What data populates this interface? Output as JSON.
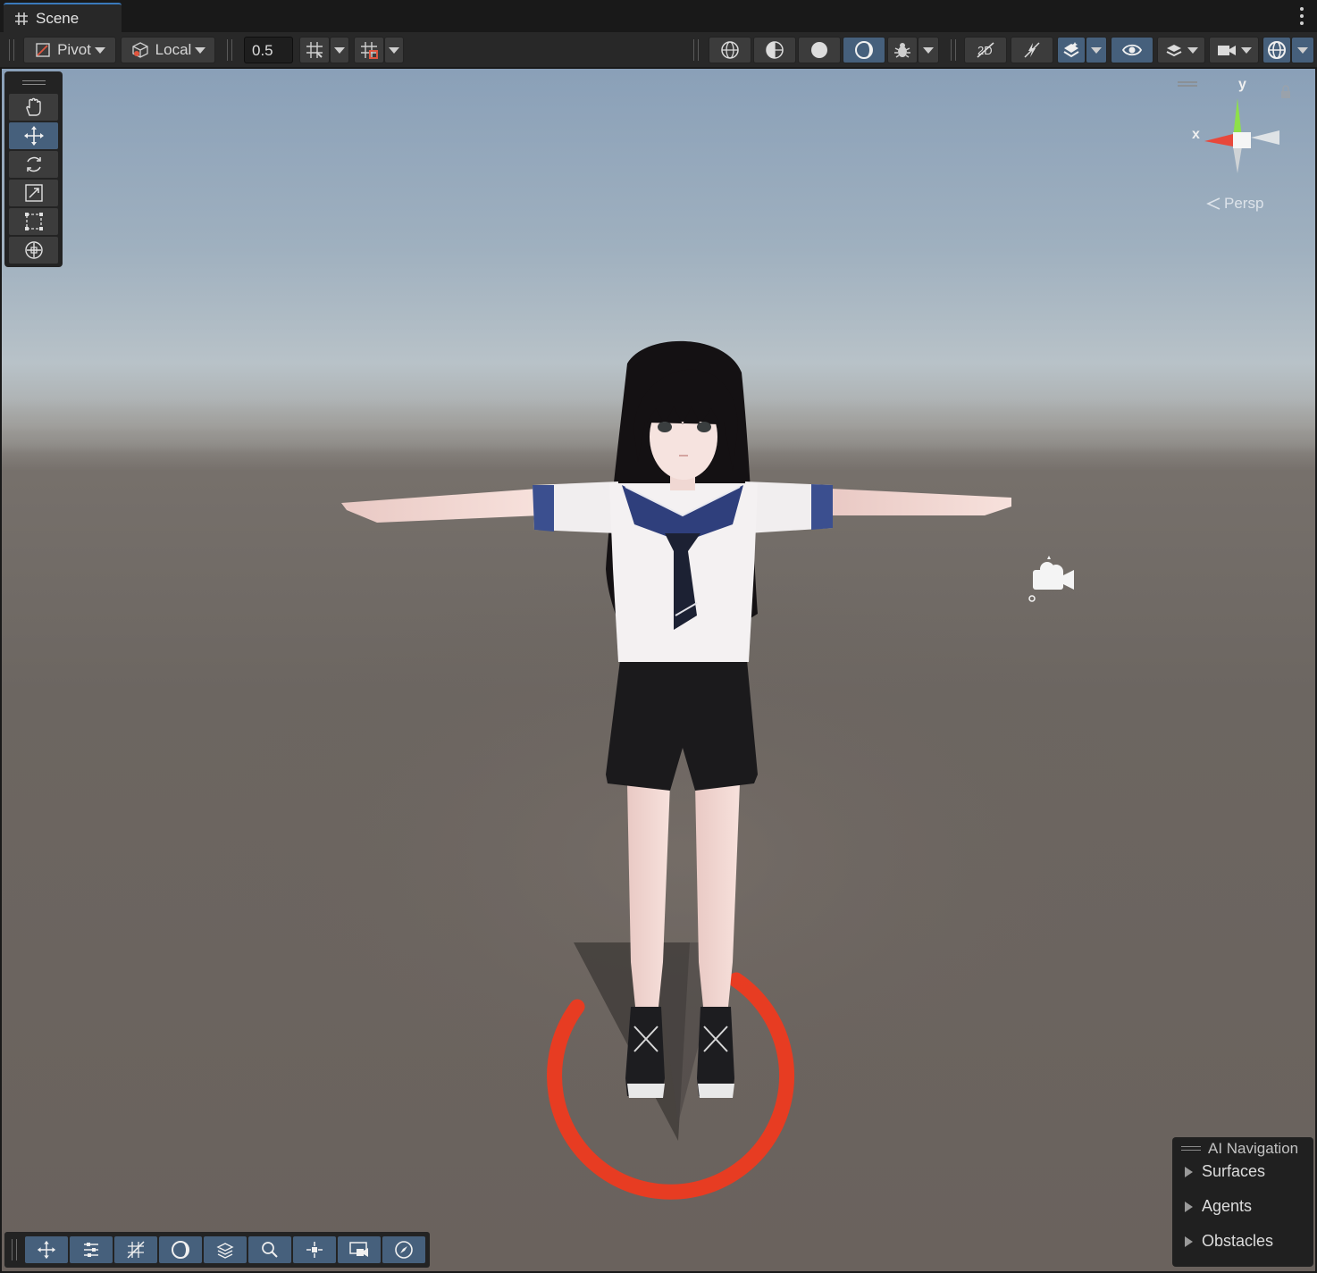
{
  "tab": {
    "title": "Scene",
    "icon": "grid-icon"
  },
  "toolbar": {
    "pivot_label": "Pivot",
    "space_label": "Local",
    "snap_value": "0.5"
  },
  "gizmo": {
    "y_label": "y",
    "x_label": "x",
    "projection_label": "Persp"
  },
  "ai_navigation": {
    "title": "AI Navigation",
    "items": [
      "Surfaces",
      "Agents",
      "Obstacles"
    ]
  },
  "colors": {
    "accent_active": "#46607c",
    "tab_accent": "#3a79bb",
    "x_axis": "#e8483b",
    "y_axis": "#8ee04a"
  }
}
